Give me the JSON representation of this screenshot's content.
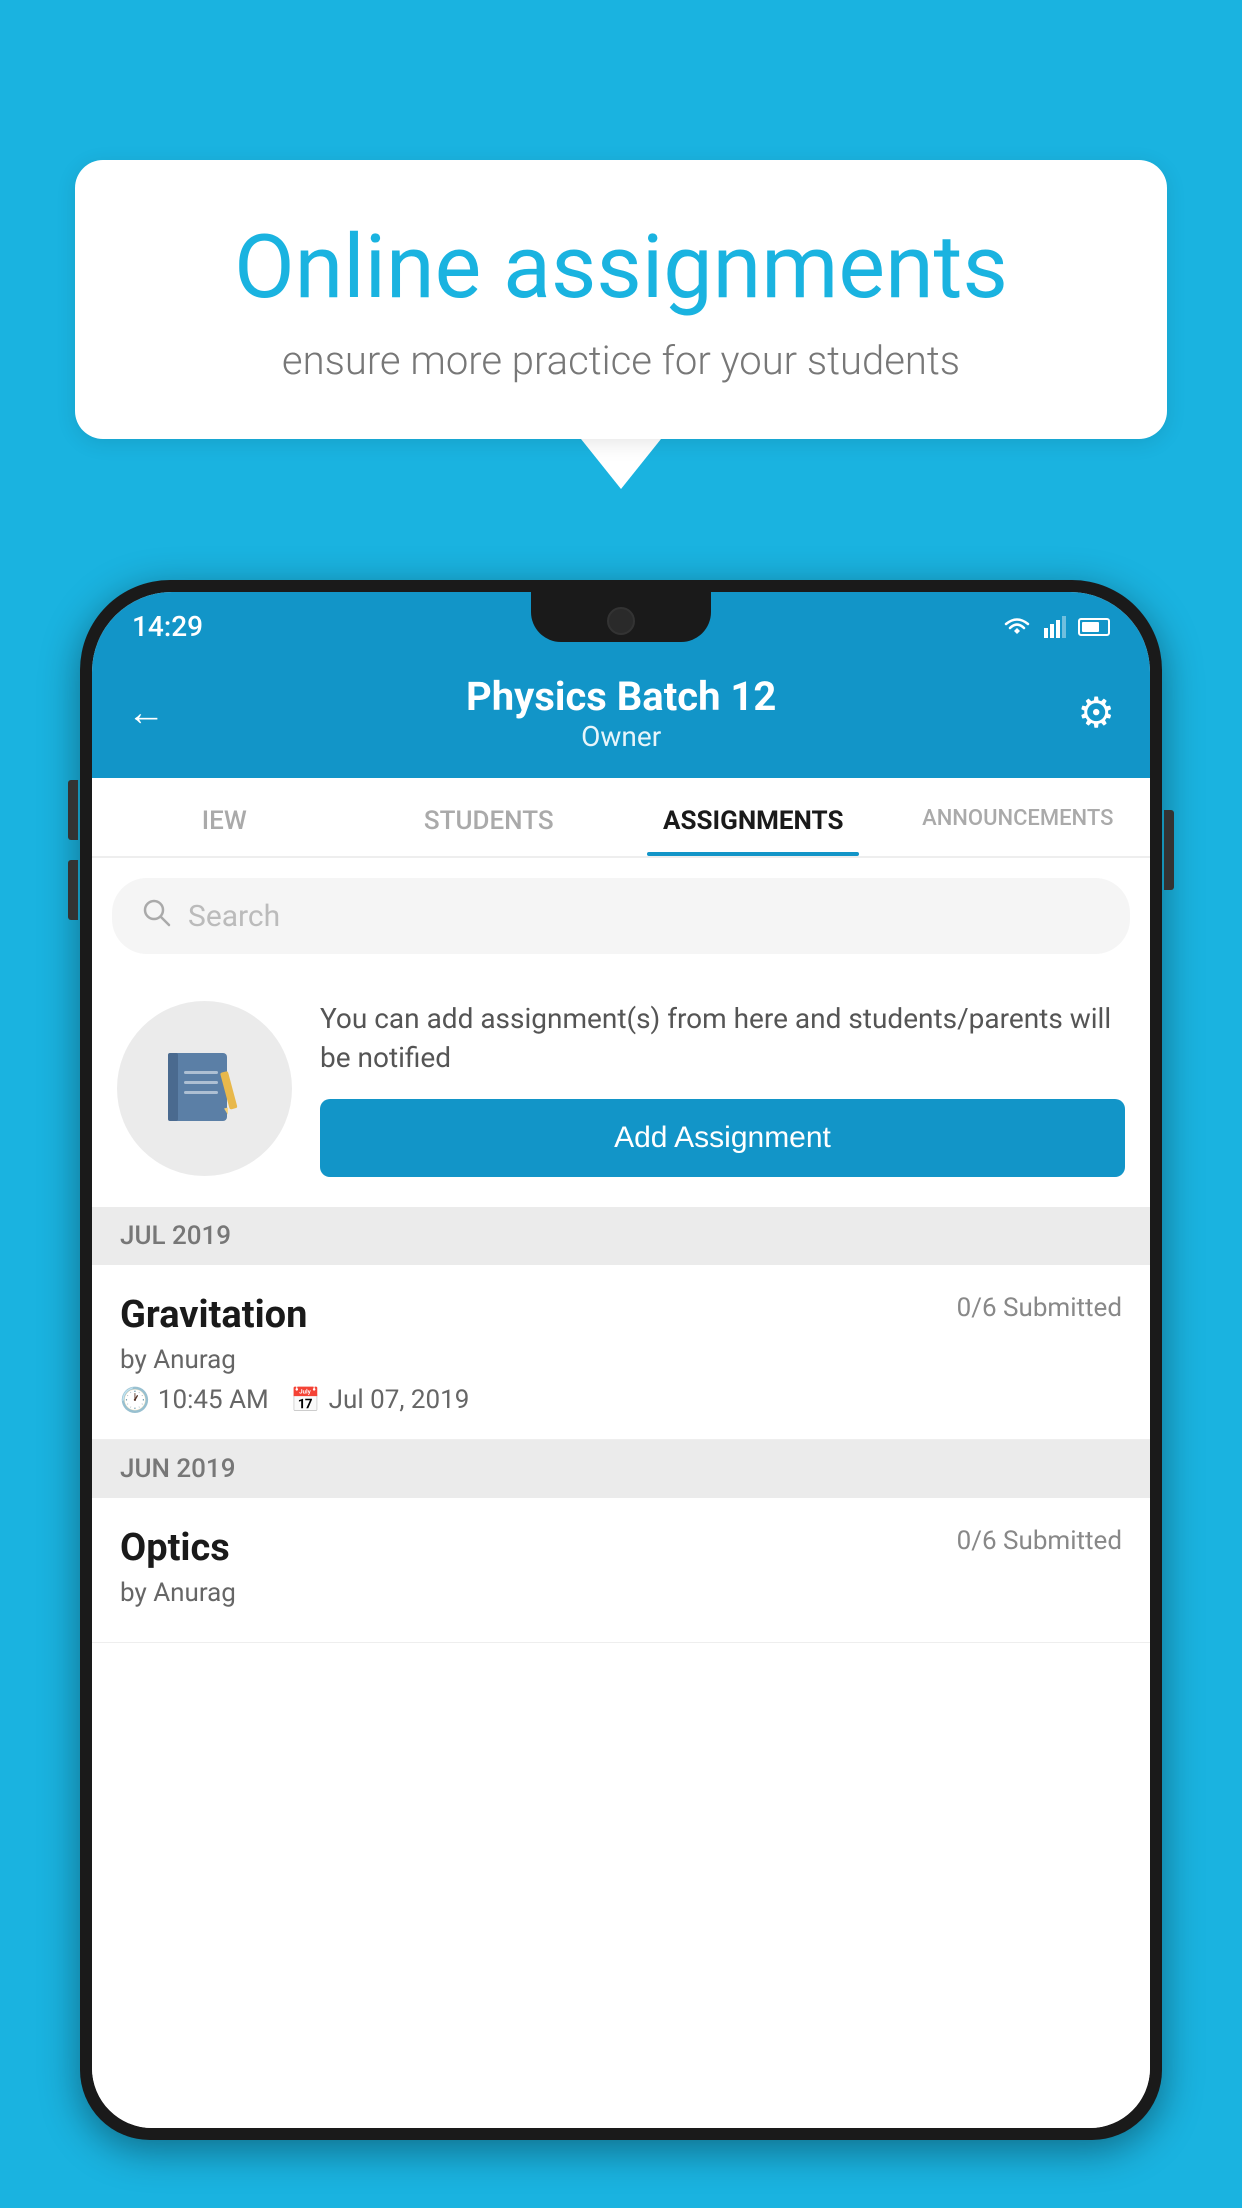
{
  "background": {
    "color": "#1ab3e0"
  },
  "speech_bubble": {
    "title": "Online assignments",
    "subtitle": "ensure more practice for your students"
  },
  "phone": {
    "status_bar": {
      "time": "14:29"
    },
    "header": {
      "title": "Physics Batch 12",
      "subtitle": "Owner",
      "back_label": "←",
      "settings_label": "⚙"
    },
    "tabs": [
      {
        "label": "IEW",
        "active": false
      },
      {
        "label": "STUDENTS",
        "active": false
      },
      {
        "label": "ASSIGNMENTS",
        "active": true
      },
      {
        "label": "ANNOUNCEMENTS",
        "active": false
      }
    ],
    "search": {
      "placeholder": "Search"
    },
    "info_section": {
      "description": "You can add assignment(s) from here and students/parents will be notified",
      "add_button_label": "Add Assignment"
    },
    "assignment_groups": [
      {
        "month": "JUL 2019",
        "assignments": [
          {
            "name": "Gravitation",
            "submitted": "0/6 Submitted",
            "by": "by Anurag",
            "time": "10:45 AM",
            "date": "Jul 07, 2019"
          }
        ]
      },
      {
        "month": "JUN 2019",
        "assignments": [
          {
            "name": "Optics",
            "submitted": "0/6 Submitted",
            "by": "by Anurag",
            "time": "",
            "date": ""
          }
        ]
      }
    ]
  }
}
